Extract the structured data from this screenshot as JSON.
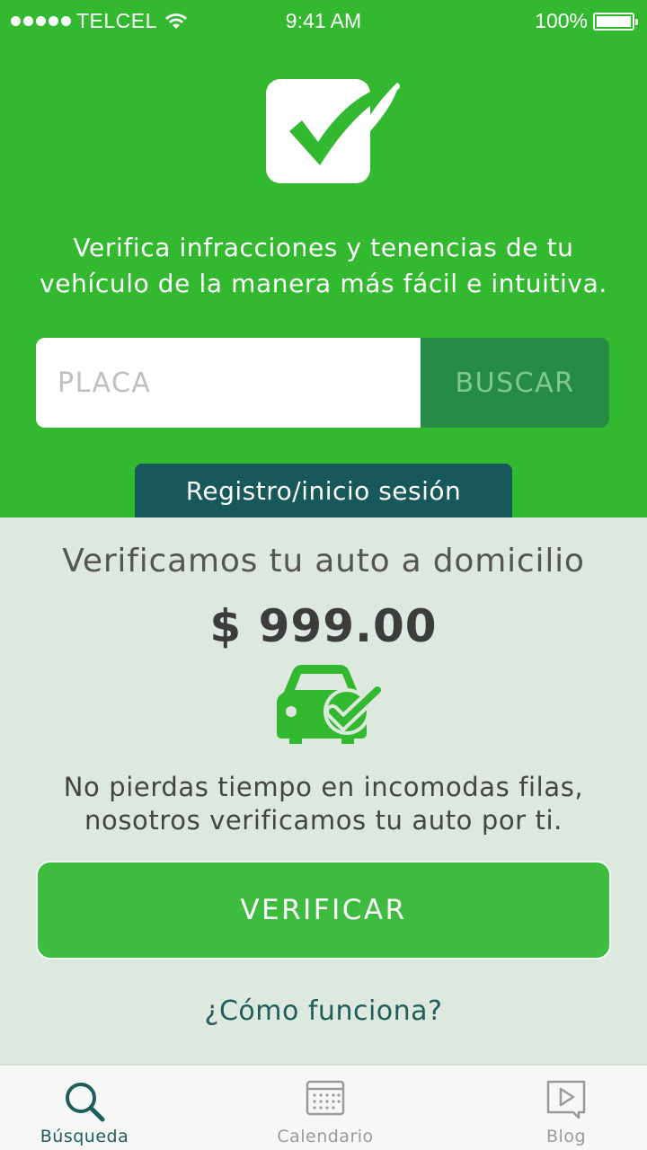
{
  "status_bar": {
    "carrier": "TELCEL",
    "time": "9:41 AM",
    "battery": "100%"
  },
  "hero": {
    "tagline_line1": "Verifica infracciones y tenencias de tu",
    "tagline_line2": "vehículo de la manera más fácil e intuitiva.",
    "search_placeholder": "PLACA",
    "search_button": "BUSCAR",
    "login_tab": "Registro/inicio sesión"
  },
  "promo": {
    "title": "Verificamos tu auto a domicilio",
    "price": "$ 999.00",
    "desc_line1": "No pierdas tiempo en incomodas filas,",
    "desc_line2": "nosotros verificamos tu auto por ti.",
    "verify_button": "VERIFICAR",
    "how_link": "¿Cómo funciona?"
  },
  "tabbar": {
    "tabs": [
      {
        "label": "Búsqueda",
        "icon": "search-icon",
        "active": true
      },
      {
        "label": "Calendario",
        "icon": "calendar-icon",
        "active": false
      },
      {
        "label": "Blog",
        "icon": "play-icon",
        "active": false
      }
    ]
  },
  "colors": {
    "brand_green": "#33b930",
    "dark_green": "#258b45",
    "teal": "#17585a",
    "background": "#dde9df"
  }
}
